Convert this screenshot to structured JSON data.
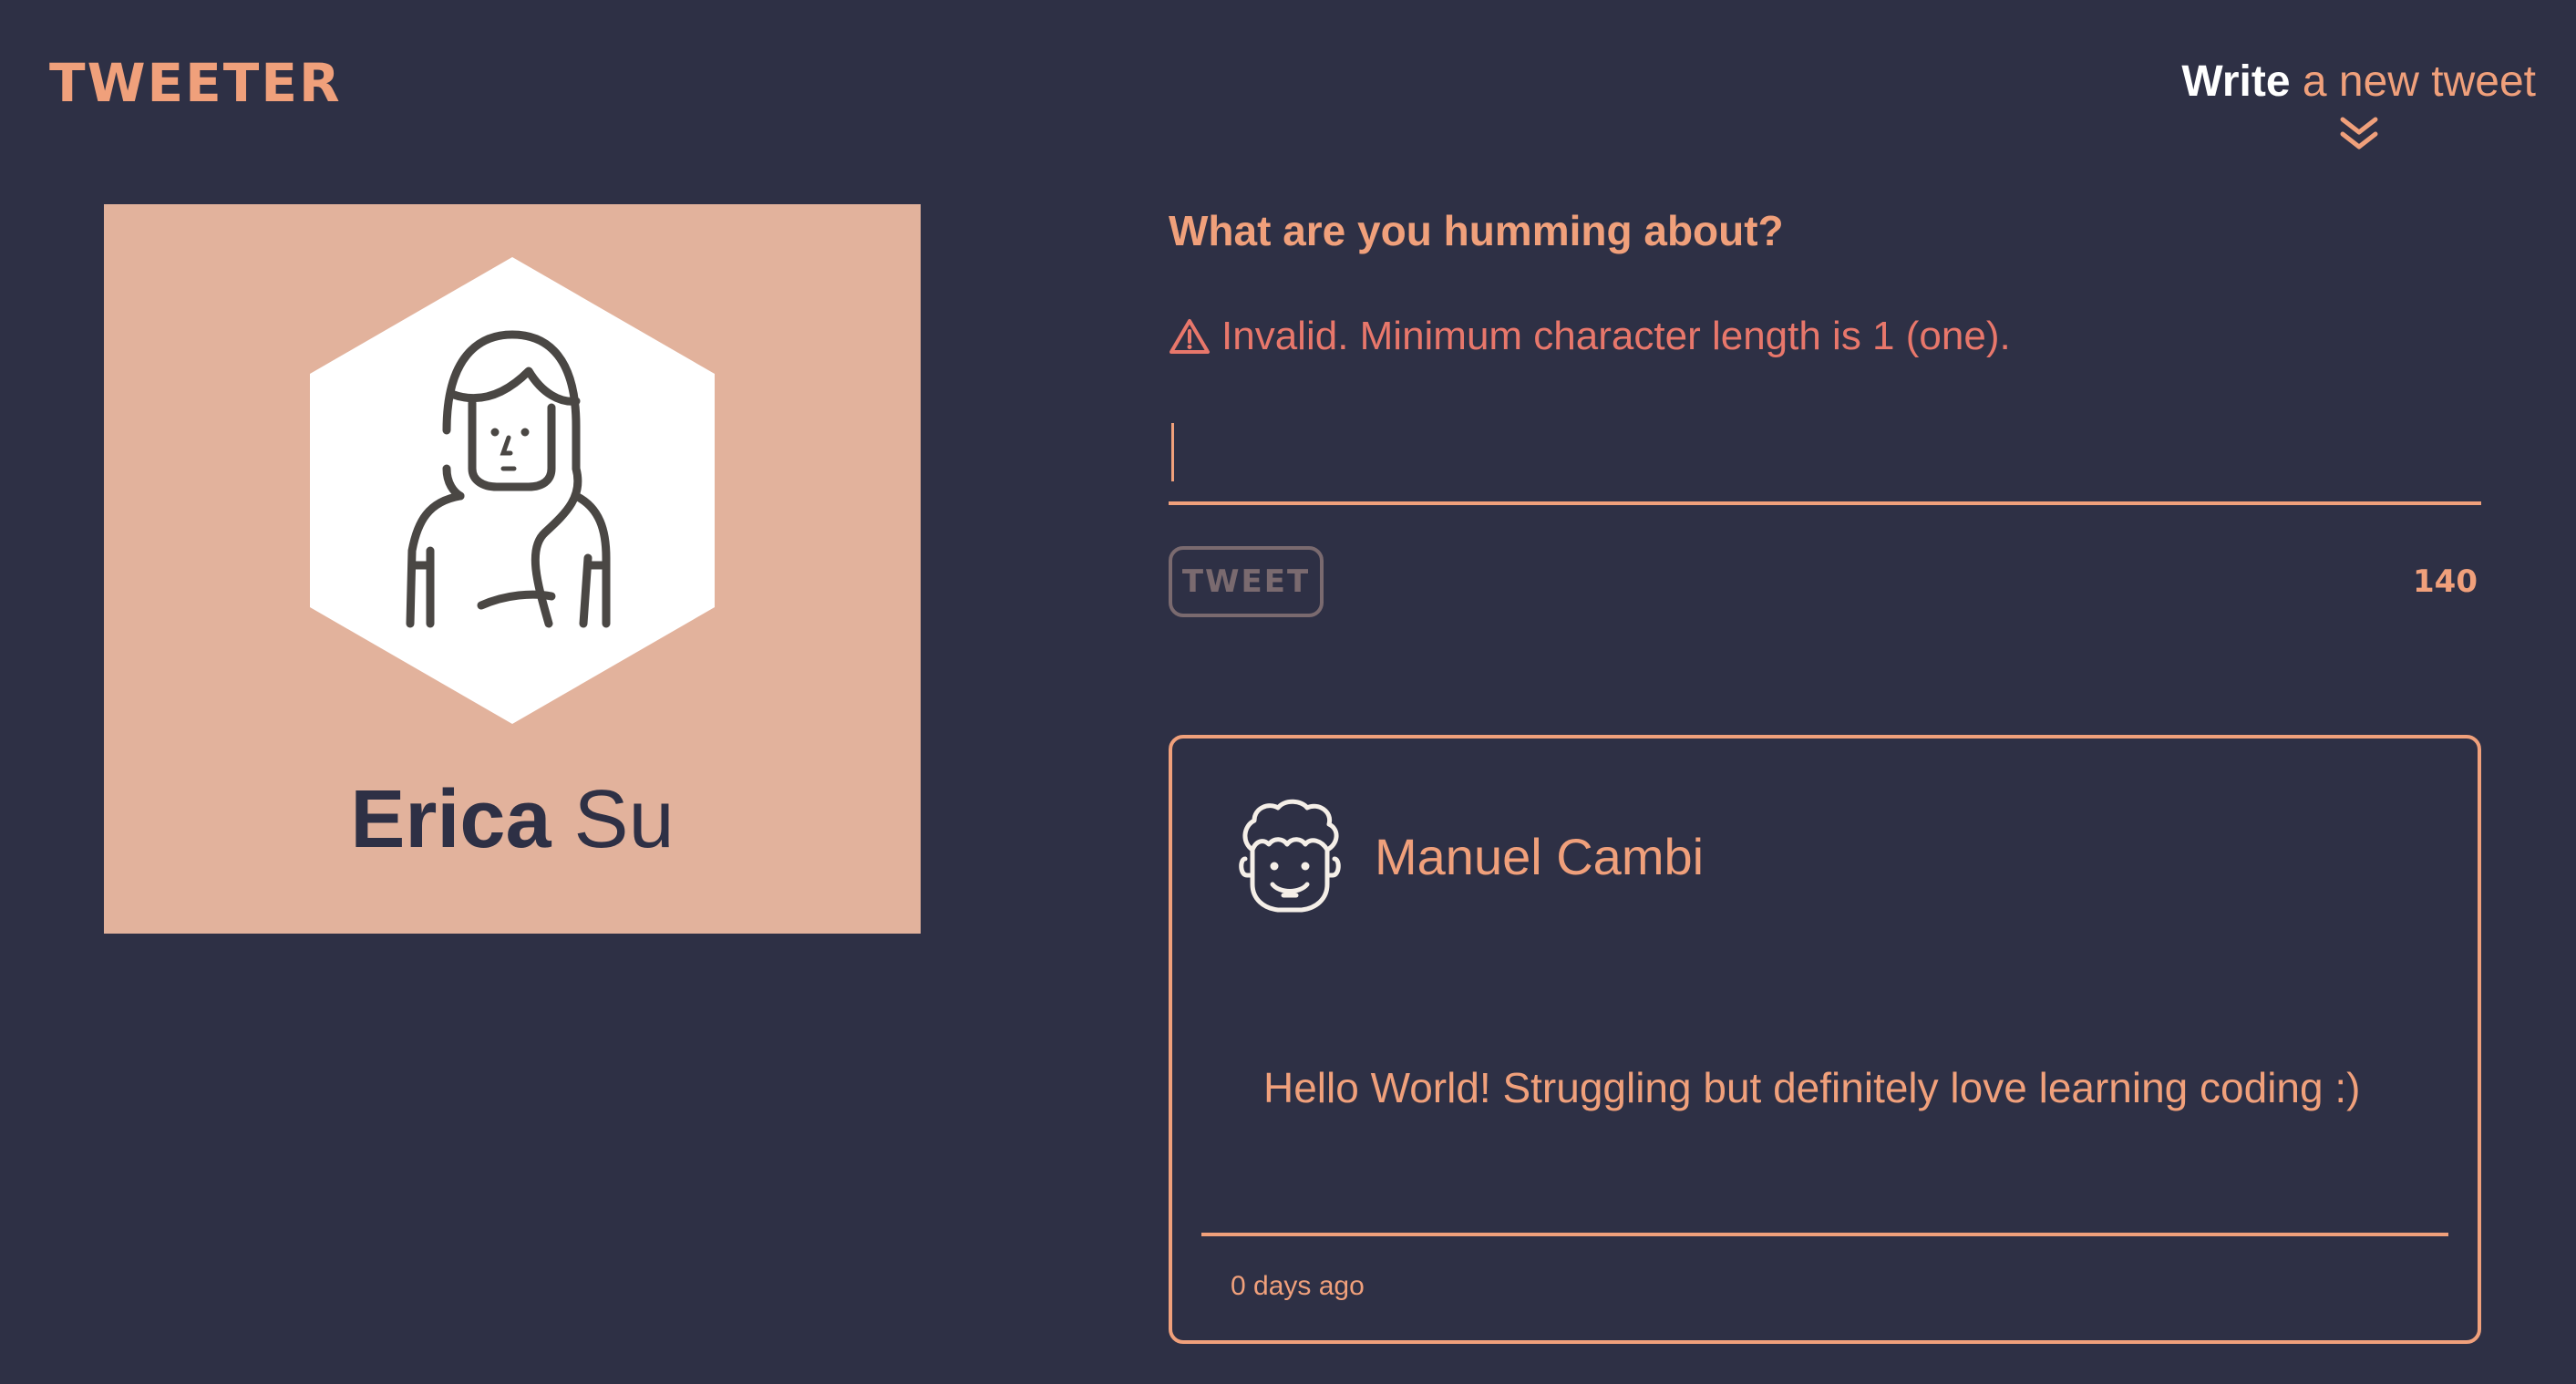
{
  "header": {
    "brand": "TWEETER",
    "write_strong": "Write",
    "write_rest": " a new tweet",
    "icon": "double-chevron-down-icon"
  },
  "profile": {
    "first_name": "Erica",
    "last_name": "Su",
    "avatar_icon": "woman-avatar-icon"
  },
  "composer": {
    "question": "What are you humming about?",
    "error": "Invalid. Minimum character length is 1 (one).",
    "error_icon": "warning-icon",
    "input_value": "",
    "button_label": "TWEET",
    "counter": "140"
  },
  "tweets": [
    {
      "author": "Manuel Cambi",
      "avatar_icon": "man-avatar-icon",
      "content": "Hello World! Struggling but definitely love learning coding :)",
      "time": "0 days ago"
    }
  ],
  "colors": {
    "background": "#2e3045",
    "accent": "#f0a07b",
    "card": "#e2b29c",
    "error": "#e8776b",
    "disabled": "#7a6a6f"
  }
}
